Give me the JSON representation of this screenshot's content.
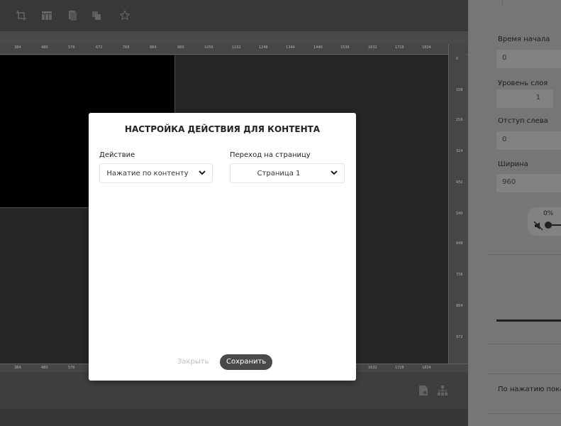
{
  "ruler": {
    "top": [
      "384",
      "480",
      "576",
      "672",
      "768",
      "864",
      "960",
      "1056",
      "1152",
      "1248",
      "1344",
      "1440",
      "1536",
      "1632",
      "1728",
      "1824",
      "1920"
    ],
    "right": [
      "0",
      "108",
      "216",
      "324",
      "432",
      "540",
      "648",
      "756",
      "864",
      "972",
      "1080"
    ],
    "bottom": [
      "384",
      "480",
      "576",
      "1632",
      "1728",
      "1824"
    ]
  },
  "toolbar": {
    "icons": [
      "crop-icon",
      "layout-icon",
      "copy-icon",
      "duplicate-icon",
      "star-icon"
    ]
  },
  "panel": {
    "start_time_label": "Время начала",
    "start_time_value": "0",
    "layer_label": "Уровень слоя",
    "layer_value": "1",
    "left_offset_label": "Отступ слева",
    "left_offset_value": "0",
    "width_label": "Ширина",
    "width_value": "960",
    "volume_percent": "0%",
    "on_click_label": "По нажатию пока"
  },
  "modal": {
    "title": "НАСТРОЙКА ДЕЙСТВИЯ ДЛЯ КОНТЕНТА",
    "action_label": "Действие",
    "action_value": "Нажатие по контенту",
    "goto_label": "Переход на страницу",
    "goto_value": "Страница 1",
    "close_label": "Закрыть",
    "save_label": "Сохранить"
  }
}
